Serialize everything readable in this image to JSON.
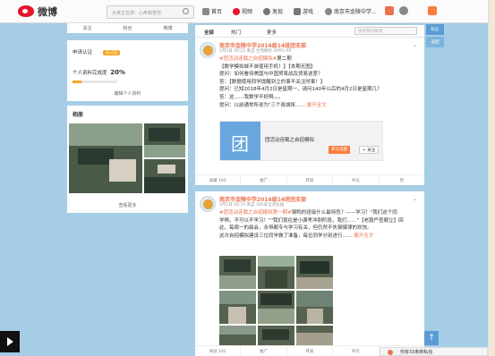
{
  "nav": {
    "logo_text": "微博",
    "search_placeholder": "大家正在搜：心疼韩雪佳",
    "items": [
      {
        "label": "首页"
      },
      {
        "label": "视频"
      },
      {
        "label": "发现"
      },
      {
        "label": "游戏"
      },
      {
        "label": "南京市金陵中学..."
      }
    ]
  },
  "left": {
    "tabs": [
      "关注",
      "粉丝",
      "微博"
    ],
    "verify_label": "申请认证",
    "verify_badge": "去认证",
    "completion_label": "个人资料完成度",
    "completion_value": "20%",
    "completion_fraction": 0.2,
    "edit_profile": "编辑个人资料",
    "album_title": "相册",
    "album_more": "查看更多"
  },
  "feed_tabs": {
    "items": [
      "全部",
      "热门",
      "更多"
    ],
    "search_placeholder": "搜索我的微博"
  },
  "post1": {
    "name": "南京市金陵中学2016级14班团支部",
    "meta": "5月3日 20:25 来自 生而拥有 OPPO R9",
    "lines": [
      {
        "hl": "#团活动连载之自招模拟#",
        "text": "第二期"
      },
      {
        "hl": "",
        "text": "【数学模拟城不准使用手机！】【本期无图】"
      },
      {
        "hl": "",
        "text": "提问：如何看待美国与中国贸易战及贸易逆差？"
      },
      {
        "hl": "",
        "text": "答：【数据使用同学提醒到立的事不关注时事！】"
      },
      {
        "hl": "",
        "text": "提问：已知2018年4月2日是星期一，请问140年以后的4月2日是星期几？"
      },
      {
        "hl": "",
        "text": "答：这……我数学不好啊。。。"
      },
      {
        "hl": "",
        "text": "提问：以前通常所说为\"三个县城将……"
      }
    ],
    "more_link": "展开全文",
    "share_title": "团活动连载之自招模拟",
    "share_glyph": "团",
    "share_btn1": "参与话题",
    "share_btn2": "+ 关注",
    "actions": [
      "收藏 160",
      "推广",
      "转发",
      "评论",
      "赞"
    ]
  },
  "post2": {
    "name": "南京市金陵中学2016级14班团支部",
    "meta": "5月1日 16:19 来自 360安全浏览器",
    "lines": [
      {
        "hl": "#团活动连载之自招模拟第一期#",
        "text": "钢鸭的班级什么最特色？——学习！\"我们这个同"
      },
      {
        "hl": "",
        "text": "学啊，不可以不学习！\"\"我们现在是小满考冲刺阶段，我们……\"【老毅严查顺立】回"
      },
      {
        "hl": "",
        "text": "此，每周一的晨会，永恒都专与学习有关，但仍然不失钢爆律的欢快。"
      },
      {
        "hl": "",
        "text": "这次自招模拟建设三位同学做了准备，每位同学分别进行……"
      }
    ],
    "more_link": "展开全文",
    "actions": [
      "阅读 182",
      "推广",
      "转发",
      "评论",
      "赞"
    ]
  },
  "right": {
    "btn1": "私信",
    "btn2": "返回"
  },
  "chat": {
    "text": "你有33条新私信"
  },
  "colors": {
    "accent": "#fa7d3c",
    "link": "#eb7350",
    "brand_red": "#e6162d",
    "page_bg": "#a5cde6"
  }
}
